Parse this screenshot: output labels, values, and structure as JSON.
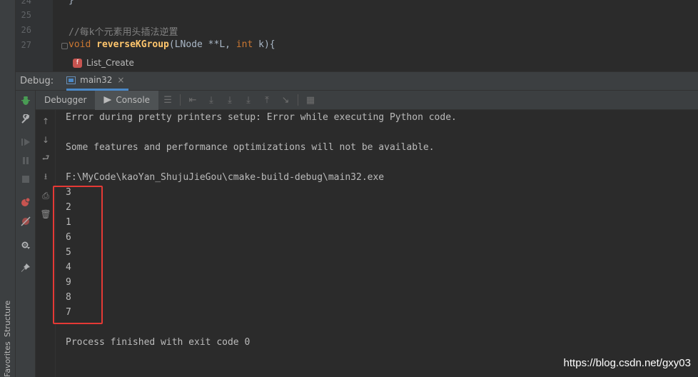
{
  "editor": {
    "lines": [
      {
        "num": "24",
        "text": "}"
      },
      {
        "num": "25",
        "text": ""
      },
      {
        "num": "26",
        "comment": "//每k个元素用头插法逆置"
      },
      {
        "num": "27",
        "kw1": "void",
        "fn": "reverseKGroup",
        "rest1": "(LNode **L, ",
        "kw2": "int",
        "rest2": " k){"
      }
    ],
    "breadcrumb_badge": "f",
    "breadcrumb": "List_Create"
  },
  "debug": {
    "label": "Debug:",
    "run_tab": "main32",
    "close": "×",
    "tabs": {
      "debugger": "Debugger",
      "console": "Console"
    }
  },
  "side_tabs": {
    "structure": "Structure",
    "favorites": "Favorites"
  },
  "console": {
    "lines": [
      "Error during pretty printers setup: Error while executing Python code.",
      "",
      "Some features and performance optimizations will not be available.",
      "",
      "F:\\MyCode\\kaoYan_ShujuJieGou\\cmake-build-debug\\main32.exe",
      "3",
      "2",
      "1",
      "6",
      "5",
      "4",
      "9",
      "8",
      "7",
      "",
      "Process finished with exit code 0"
    ]
  },
  "watermark": "https://blog.csdn.net/gxy03",
  "colors": {
    "highlight": "#e53935",
    "accent": "#4a88c7"
  }
}
